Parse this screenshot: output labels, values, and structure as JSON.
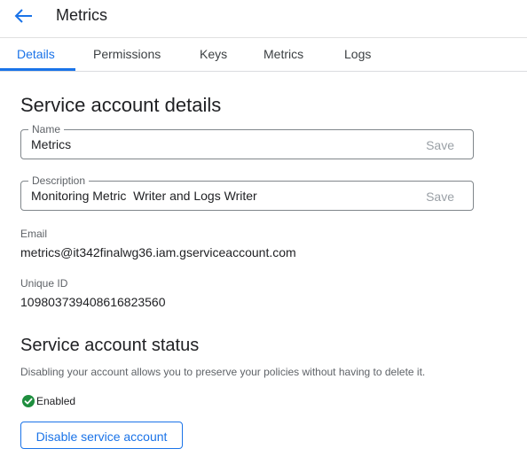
{
  "header": {
    "title": "Metrics"
  },
  "tabs": [
    {
      "label": "Details"
    },
    {
      "label": "Permissions"
    },
    {
      "label": "Keys"
    },
    {
      "label": "Metrics"
    },
    {
      "label": "Logs"
    }
  ],
  "details": {
    "section_title": "Service account details",
    "name_field": {
      "label": "Name",
      "value": "Metrics",
      "save_label": "Save"
    },
    "description_field": {
      "label": "Description",
      "value": "Monitoring Metric  Writer and Logs Writer",
      "save_label": "Save"
    },
    "email": {
      "label": "Email",
      "value": "metrics@it342finalwg36.iam.gserviceaccount.com"
    },
    "unique_id": {
      "label": "Unique ID",
      "value": "109803739408616823560"
    }
  },
  "status": {
    "section_title": "Service account status",
    "help_text": "Disabling your account allows you to preserve your policies without having to delete it.",
    "state_label": "Enabled",
    "state_color": "#1e8e3e",
    "disable_button_label": "Disable service account"
  },
  "colors": {
    "accent": "#1a73e8"
  }
}
